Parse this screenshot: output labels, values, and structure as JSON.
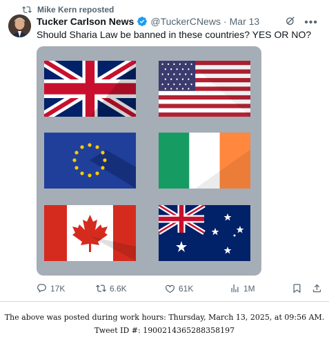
{
  "repost": {
    "icon": "repost-icon",
    "label": "Mike Kern reposted"
  },
  "tweet": {
    "author_name": "Tucker Carlson News",
    "verified": true,
    "handle": "@TuckerCNews",
    "separator": "·",
    "date": "Mar 13",
    "text": "Should Sharia Law be banned in these countries? YES OR NO?",
    "media": {
      "flags": [
        "united-kingdom-flag",
        "united-states-flag",
        "european-union-flag",
        "ireland-flag",
        "canada-flag",
        "australia-flag"
      ]
    },
    "stats": {
      "replies": "17K",
      "reposts": "6.6K",
      "likes": "61K",
      "views": "1M"
    }
  },
  "footer": {
    "line1": "The above was posted during work hours: Thursday, March 13, 2025, at 09:56 AM.",
    "line2": "Tweet ID #: 1900214365288358197"
  },
  "colors": {
    "verified": "#1d9bf0",
    "muted": "#536471",
    "media_bg": "#a5adb6"
  }
}
